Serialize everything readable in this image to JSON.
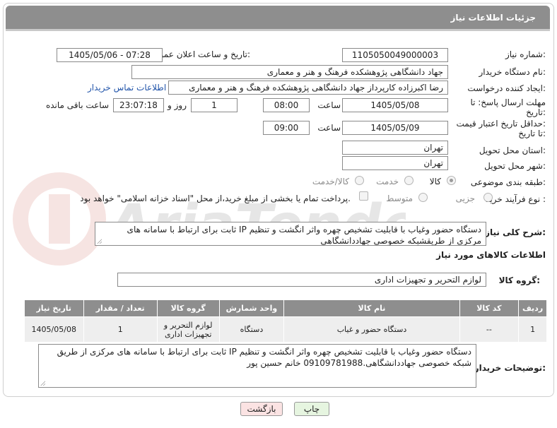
{
  "header": {
    "title": "جزئیات اطلاعات نیاز"
  },
  "watermark": {
    "text": "AriaTender.net"
  },
  "need_number": {
    "label": "شماره نیاز:",
    "value": "1105050049000003"
  },
  "announce": {
    "label": "تاریخ و ساعت اعلان عمومی:",
    "value": "1405/05/06 - 07:28"
  },
  "buyer_org": {
    "label": "نام دستگاه خریدار:",
    "value": "جهاد دانشگاهی پژوهشکده فرهنگ و هنر و معماری"
  },
  "requester": {
    "label": "ایجاد کننده درخواست:",
    "value": "رضا اکبرزاده کارپرداز جهاد دانشگاهی پژوهشکده فرهنگ و هنر و معماری",
    "contact_link": "اطلاعات تماس خریدار"
  },
  "reply_deadline": {
    "label_line1": "مهلت ارسال پاسخ: تا",
    "label_line2": "تاریخ:",
    "date": "1405/05/08",
    "time_label": "ساعت",
    "time": "08:00",
    "days": "1",
    "days_label": "روز و",
    "remaining_time": "23:07:18",
    "remaining_label": "ساعت باقی مانده"
  },
  "price_validity": {
    "label_line1": "حداقل تاریخ اعتبار قیمت:",
    "label_line2": "تا تاریخ:",
    "date": "1405/05/09",
    "time_label": "ساعت",
    "time": "09:00"
  },
  "delivery_province": {
    "label": "استان محل تحویل:",
    "value": "تهران"
  },
  "delivery_city": {
    "label": "شهر محل تحویل:",
    "value": "تهران"
  },
  "category": {
    "label": "طبقه بندی موضوعی:",
    "options": [
      "کالا",
      "خدمت",
      "کالا/خدمت"
    ],
    "selected": "کالا"
  },
  "process": {
    "label": "نوع فرآیند خرید :",
    "options": [
      "جزیی",
      "متوسط"
    ],
    "payment_note": "پرداخت تمام یا بخشی از مبلغ خرید،از محل \"اسناد خزانه اسلامی\" خواهد بود."
  },
  "general_desc": {
    "label": "شرح کلی نیاز:",
    "value": "دستگاه حضور وغیاب با قابلیت تشخیص چهره واثر انگشت و تنظیم IP ثابت برای ارتباط با سامانه های مرکزی از طریقشبکه خصوصی جهاددانشگاهی"
  },
  "goods_info": {
    "title": "اطلاعات کالاهای مورد نیاز"
  },
  "goods_group": {
    "label": "گروه کالا:",
    "value": "لوازم التحریر و تجهیزات اداری"
  },
  "table": {
    "headers": {
      "row": "ردیف",
      "code": "کد کالا",
      "name": "نام کالا",
      "unit": "واحد شمارش",
      "group": "گروه کالا",
      "qty": "تعداد / مقدار",
      "date": "تاریخ نیاز"
    },
    "rows": [
      {
        "row": "1",
        "code": "--",
        "name": "دستگاه حضور و غیاب",
        "unit": "دستگاه",
        "group": "لوازم التحریر و تجهیزات اداری",
        "qty": "1",
        "date": "1405/05/08"
      }
    ]
  },
  "buyer_notes": {
    "label": "توضیحات خریدار:",
    "value": "دستگاه حضور وغیاب با قابلیت تشخیص چهره واثر انگشت و تنظیم IP ثابت برای ارتباط با سامانه های مرکزی از طریق شبکه خصوصی جهاددانشگاهی.09109781988 خانم حسین پور"
  },
  "buttons": {
    "print": "چاپ",
    "back": "بازگشت"
  }
}
